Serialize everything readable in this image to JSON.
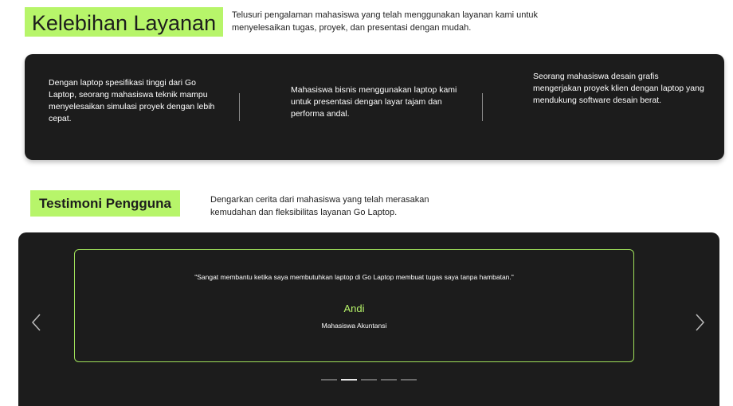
{
  "section1": {
    "title": "Kelebihan Layanan",
    "description": "Telusuri pengalaman mahasiswa yang telah menggunakan layanan kami untuk menyelesaikan tugas, proyek, dan presentasi dengan mudah.",
    "features": [
      "Dengan laptop spesifikasi tinggi dari Go Laptop, seorang mahasiswa teknik mampu menyelesaikan simulasi proyek dengan lebih cepat.",
      "Mahasiswa bisnis menggunakan laptop kami untuk presentasi dengan layar tajam dan performa andal.",
      "Seorang mahasiswa desain grafis mengerjakan proyek klien dengan laptop yang mendukung software desain berat."
    ]
  },
  "section2": {
    "title": "Testimoni Pengguna",
    "description": "Dengarkan cerita dari mahasiswa yang telah merasakan kemudahan dan fleksibilitas layanan Go Laptop."
  },
  "carousel": {
    "quote": "\"Sangat membantu ketika saya membutuhkan laptop di Go Laptop membuat tugas saya tanpa hambatan.\"",
    "author": "Andi",
    "role": "Mahasiswa Akuntansi",
    "prev_icon": "chevron-left-icon",
    "next_icon": "chevron-right-icon",
    "indicator_count": 5,
    "active_index": 1
  },
  "colors": {
    "accent": "#b7f56a",
    "dark_bg": "#1c1c1c",
    "slide_border": "#9fe05a"
  }
}
